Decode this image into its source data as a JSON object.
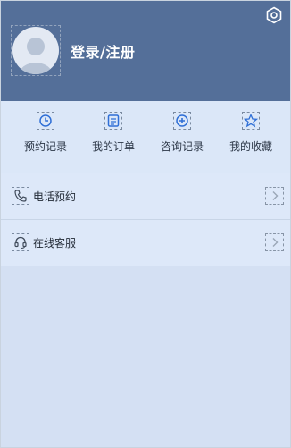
{
  "header": {
    "login_text": "登录/注册",
    "bg_color": "#546f99",
    "avatar_icon": "user-avatar-icon",
    "settings_icon": "gear-icon"
  },
  "quick_actions": [
    {
      "label": "预约记录",
      "icon": "clock-icon"
    },
    {
      "label": "我的订单",
      "icon": "order-list-icon"
    },
    {
      "label": "咨询记录",
      "icon": "consult-plus-icon"
    },
    {
      "label": "我的收藏",
      "icon": "star-icon"
    }
  ],
  "menu": [
    {
      "label": "电话预约",
      "icon": "phone-icon",
      "arrow": "chevron-right-icon"
    },
    {
      "label": "在线客服",
      "icon": "headset-icon",
      "arrow": "chevron-right-icon"
    }
  ],
  "colors": {
    "accent": "#2f6fd6",
    "page_bg": "#d4e0f3"
  }
}
